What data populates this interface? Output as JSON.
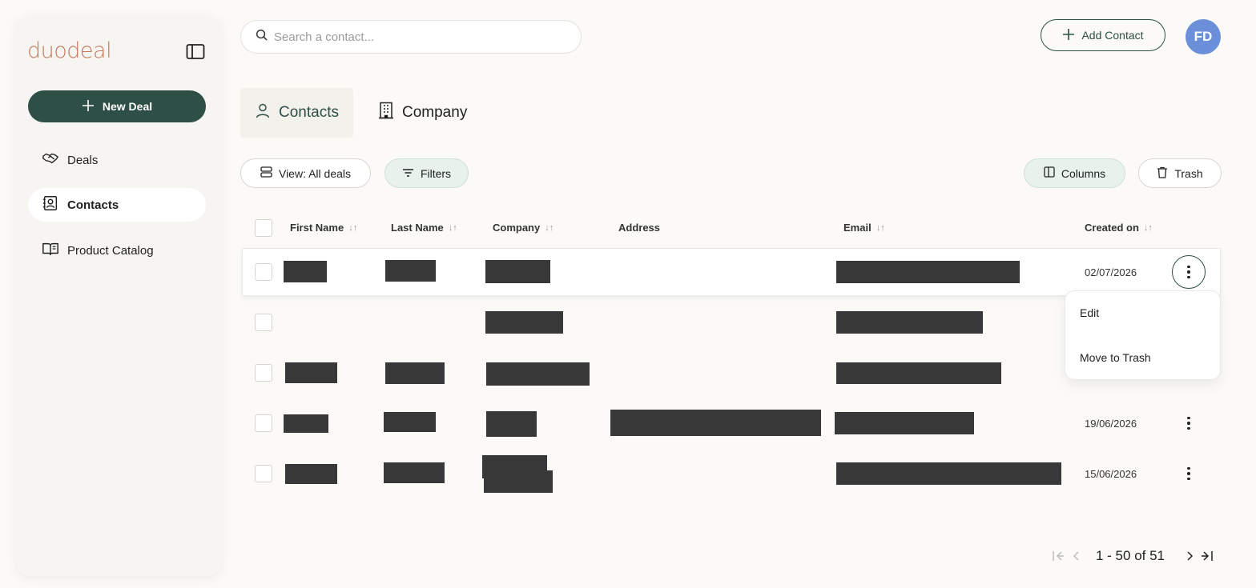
{
  "sidebar": {
    "logo": "duodeal",
    "new_deal_label": "New Deal",
    "items": [
      {
        "label": "Deals",
        "icon": "handshake-icon",
        "active": false
      },
      {
        "label": "Contacts",
        "icon": "contact-card-icon",
        "active": true
      },
      {
        "label": "Product Catalog",
        "icon": "book-icon",
        "active": false
      }
    ]
  },
  "header": {
    "search_placeholder": "Search a contact...",
    "add_contact_label": "Add Contact",
    "avatar_initials": "FD"
  },
  "tabs": [
    {
      "label": "Contacts",
      "active": true
    },
    {
      "label": "Company",
      "active": false
    }
  ],
  "toolbar": {
    "view_label": "View: All deals",
    "filters_label": "Filters",
    "columns_label": "Columns",
    "trash_label": "Trash"
  },
  "table": {
    "columns": [
      "First Name",
      "Last Name",
      "Company",
      "Address",
      "Email",
      "Created on"
    ],
    "rows": [
      {
        "created_on": "02/07/2026"
      },
      {
        "created_on": ""
      },
      {
        "created_on": ""
      },
      {
        "created_on": "19/06/2026"
      },
      {
        "created_on": "15/06/2026"
      }
    ]
  },
  "row_menu": {
    "items": [
      "Edit",
      "Move to Trash"
    ]
  },
  "pagination": {
    "text": "1 - 50 of 51"
  },
  "colors": {
    "brand_green": "#2e4f46",
    "logo_accent": "#c27a5e",
    "avatar_bg": "#6b8fd9"
  }
}
